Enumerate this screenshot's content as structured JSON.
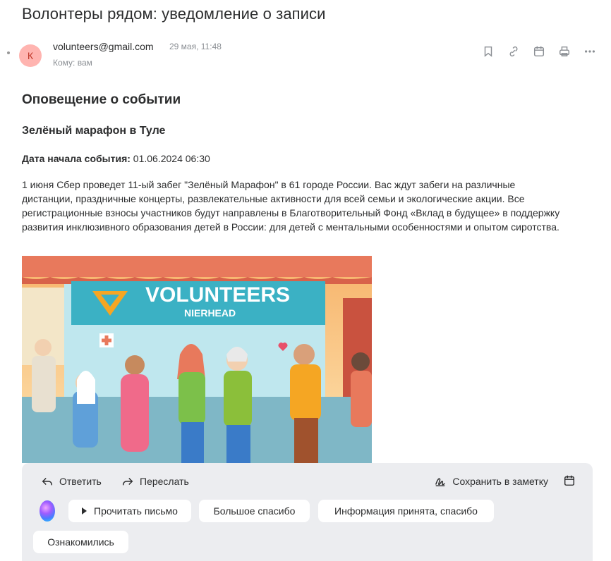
{
  "email": {
    "subject": "Волонтеры рядом: уведомление о записи",
    "avatar_letter": "К",
    "sender": "volunteers@gmail.com",
    "date": "29 мая, 11:48",
    "to": "Кому: вам"
  },
  "toolbar_icons": [
    "bookmark-icon",
    "link-icon",
    "calendar-icon",
    "print-icon",
    "more-icon"
  ],
  "content": {
    "heading": "Оповещение о событии",
    "event_title": "Зелёный марафон в Туле",
    "start_label": "Дата начала события:",
    "start_value": " 01.06.2024 06:30",
    "paragraph": "1 июня Сбер проведет 11-ый забег \"Зелёный Марафон\" в 61 городе России. Вас ждут забеги на различные дистанции, праздничные концерты, развлекательные активности для всей семьи и экологические акции. Все регистрационные взносы участников будут направлены в Благотворительный Фонд «Вклад в будущее» в поддержку развития инклюзивного образования детей в России: для детей с ментальными особенностями и опытом сиротства.",
    "image_banner_1": "VOLUNTEERS",
    "image_banner_2": "NIERHEAD"
  },
  "actions": {
    "reply": "Ответить",
    "forward": "Переслать",
    "save_note": "Сохранить в заметку"
  },
  "quick_replies": {
    "read": "Прочитать письмо",
    "thanks": "Большое спасибо",
    "info": "Информация принята, спасибо",
    "ack": "Ознакомились"
  },
  "colors": {
    "avatar_bg": "#ffb4b0",
    "panel_bg": "#ecedf0",
    "muted_text": "#8b8f94"
  }
}
